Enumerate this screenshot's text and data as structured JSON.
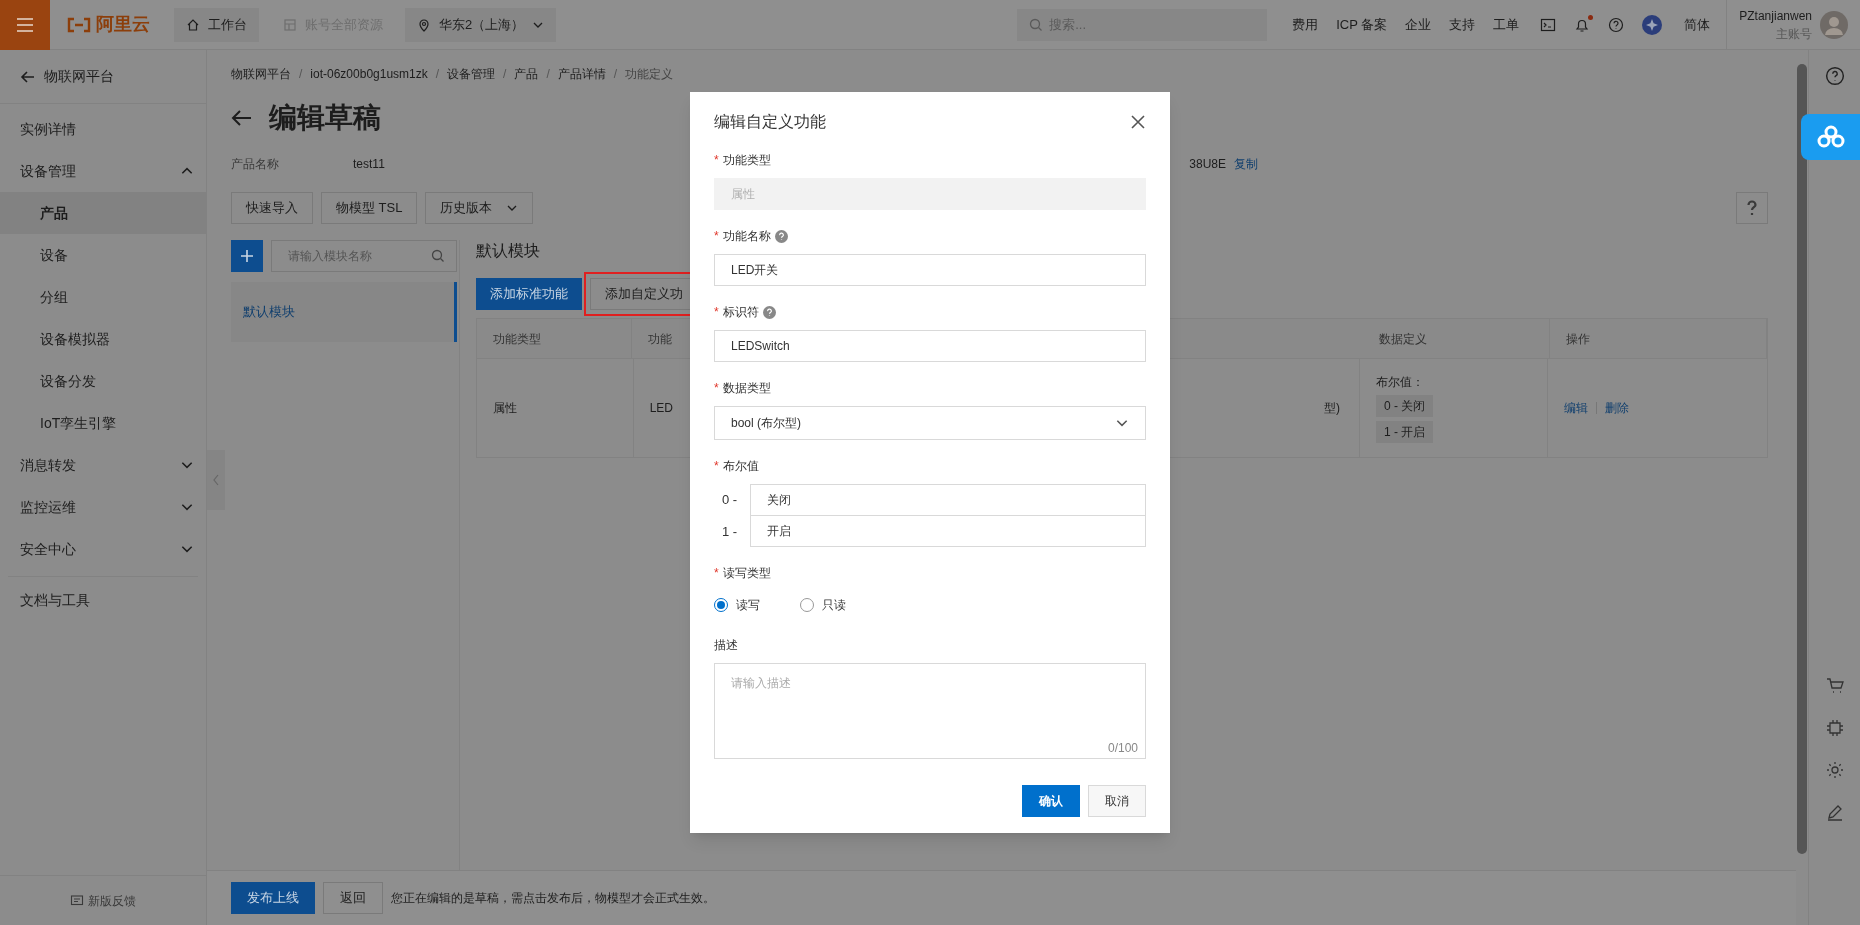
{
  "topbar": {
    "logo": "阿里云",
    "workbench": "工作台",
    "resources": "账号全部资源",
    "region": "华东2（上海）",
    "search_placeholder": "搜索...",
    "links": [
      "费用",
      "ICP 备案",
      "企业",
      "支持",
      "工单"
    ],
    "notification_dot": true,
    "language": "简体",
    "user": "PZtanjianwen",
    "account_type": "主账号"
  },
  "sidebar": {
    "back": "物联网平台",
    "items": [
      {
        "label": "实例详情",
        "selected": false
      },
      {
        "label": "设备管理",
        "selected": false,
        "expanded": true,
        "children": [
          {
            "label": "产品",
            "selected": true
          },
          {
            "label": "设备",
            "selected": false
          },
          {
            "label": "分组",
            "selected": false
          },
          {
            "label": "设备模拟器",
            "selected": false
          },
          {
            "label": "设备分发",
            "selected": false
          },
          {
            "label": "IoT孪生引擎",
            "selected": false
          }
        ]
      },
      {
        "label": "消息转发",
        "selected": false,
        "expanded": false
      },
      {
        "label": "监控运维",
        "selected": false,
        "expanded": false
      },
      {
        "label": "安全中心",
        "selected": false,
        "expanded": false
      }
    ],
    "footer_item": "文档与工具",
    "feedback": "新版反馈"
  },
  "breadcrumb": {
    "separator": "/",
    "items": [
      "物联网平台",
      "iot-06z00b0g1usm1zk",
      "设备管理",
      "产品",
      "产品详情",
      "功能定义"
    ]
  },
  "title": "编辑草稿",
  "product": {
    "label": "产品名称",
    "value": "test11",
    "key_fragment": "38U8E",
    "copy": "复制"
  },
  "toolbar": [
    {
      "label": "快速导入",
      "kind": "plain"
    },
    {
      "label": "物模型 TSL",
      "kind": "plain"
    },
    {
      "label": "历史版本",
      "kind": "dropdown"
    }
  ],
  "modules": {
    "search_placeholder": "请输入模块名称",
    "items": [
      {
        "label": "默认模块",
        "selected": true
      }
    ]
  },
  "module_title": "默认模块",
  "actions": [
    {
      "label": "添加标准功能",
      "kind": "primary",
      "highlighted": false
    },
    {
      "label": "添加自定义功",
      "kind": "secondary",
      "highlighted": true
    }
  ],
  "table": {
    "columns": [
      "功能类型",
      "功能",
      "数据定义",
      "操作"
    ],
    "rows": [
      {
        "type": "属性",
        "name": "LED",
        "data_type": "型)",
        "definition_title": "布尔值：",
        "definition_values": [
          "0 - 关闭",
          "1 - 开启"
        ],
        "actions": [
          "编辑",
          "删除"
        ]
      }
    ]
  },
  "bottom_bar": {
    "publish": "发布上线",
    "back": "返回",
    "notice": "您正在编辑的是草稿，需点击发布后，物模型才会正式生效。"
  },
  "dialog": {
    "title": "编辑自定义功能",
    "fields": [
      {
        "kind": "readonly",
        "label": "功能类型",
        "required_mark": "*",
        "disabled": true,
        "value": "属性"
      },
      {
        "kind": "text",
        "label": "功能名称",
        "required_mark": "*",
        "help": true,
        "value": "LED开关"
      },
      {
        "kind": "text",
        "label": "标识符",
        "required_mark": "*",
        "help": true,
        "value": "LEDSwitch"
      },
      {
        "kind": "select",
        "label": "数据类型",
        "required_mark": "*",
        "value": "bool (布尔型)"
      },
      {
        "kind": "bool_map",
        "label": "布尔值",
        "required_mark": "*",
        "rows": [
          {
            "key": "0 -",
            "value": "关闭"
          },
          {
            "key": "1 -",
            "value": "开启"
          }
        ]
      },
      {
        "kind": "radio",
        "label": "读写类型",
        "required_mark": "*",
        "options": [
          {
            "label": "读写",
            "selected": true
          },
          {
            "label": "只读",
            "selected": false
          }
        ]
      },
      {
        "kind": "textarea",
        "label": "描述",
        "placeholder": "请输入描述",
        "counter": "0/100"
      }
    ],
    "confirm": "确认",
    "cancel": "取消"
  }
}
